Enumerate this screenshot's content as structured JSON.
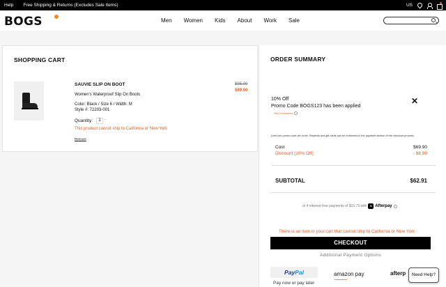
{
  "topbar": {
    "help": "Help",
    "promo": "Free Shipping & Returns (Excludes Sale Items)",
    "country": "US"
  },
  "header": {
    "logo": "BOGS",
    "nav": [
      "Men",
      "Women",
      "Kids",
      "About",
      "Work",
      "Sale"
    ]
  },
  "cart": {
    "title": "SHOPPING CART",
    "item": {
      "name": "SAUVIE SLIP ON BOOT",
      "description": "Women's Waterproof Slip On Boots",
      "attributes": "Color: Black  /  Size 6  /  Width: M",
      "style": "Style #: 72203-001",
      "quantity_label": "Quantity:",
      "quantity": "1",
      "quantity_minus": "-",
      "warning": "This product cannot ship to California or New York",
      "remove": "Remove",
      "price_original": "$95.00",
      "price_sale": "$69.90"
    }
  },
  "summary": {
    "title": "ORDER SUMMARY",
    "promo_percent": "10% Off",
    "promo_applied": "Promo Code BOGS123 has been applied",
    "promo_close": "✕",
    "exclusions": "See Exclusions",
    "fineprint": "Limit one promo code per order. Rewards and gift cards can be redeemed in the payment section of the checkout process.",
    "cost_label": "Cost",
    "cost_value": "$69.90",
    "discount_label": "Discount (10% Off)",
    "discount_value": "- $6.99",
    "subtotal_label": "SUBTOTAL",
    "subtotal_value": "$62.91",
    "afterpay_text": "or 4 interest-free payments of $15.73 with",
    "afterpay_badge": "a",
    "afterpay_name": "Afterpay",
    "ship_warning": "There is an item in your cart that cannot ship to California or New York",
    "checkout": "CHECKOUT",
    "additional_payment": "Additional Payment Options",
    "paypal_part1": "Pay",
    "paypal_part2": "Pal",
    "paypal_note": "Pay now or pay later",
    "amazon": "amazon pay",
    "afterpay_logo": "afterp"
  },
  "help_button": "Need Help?"
}
